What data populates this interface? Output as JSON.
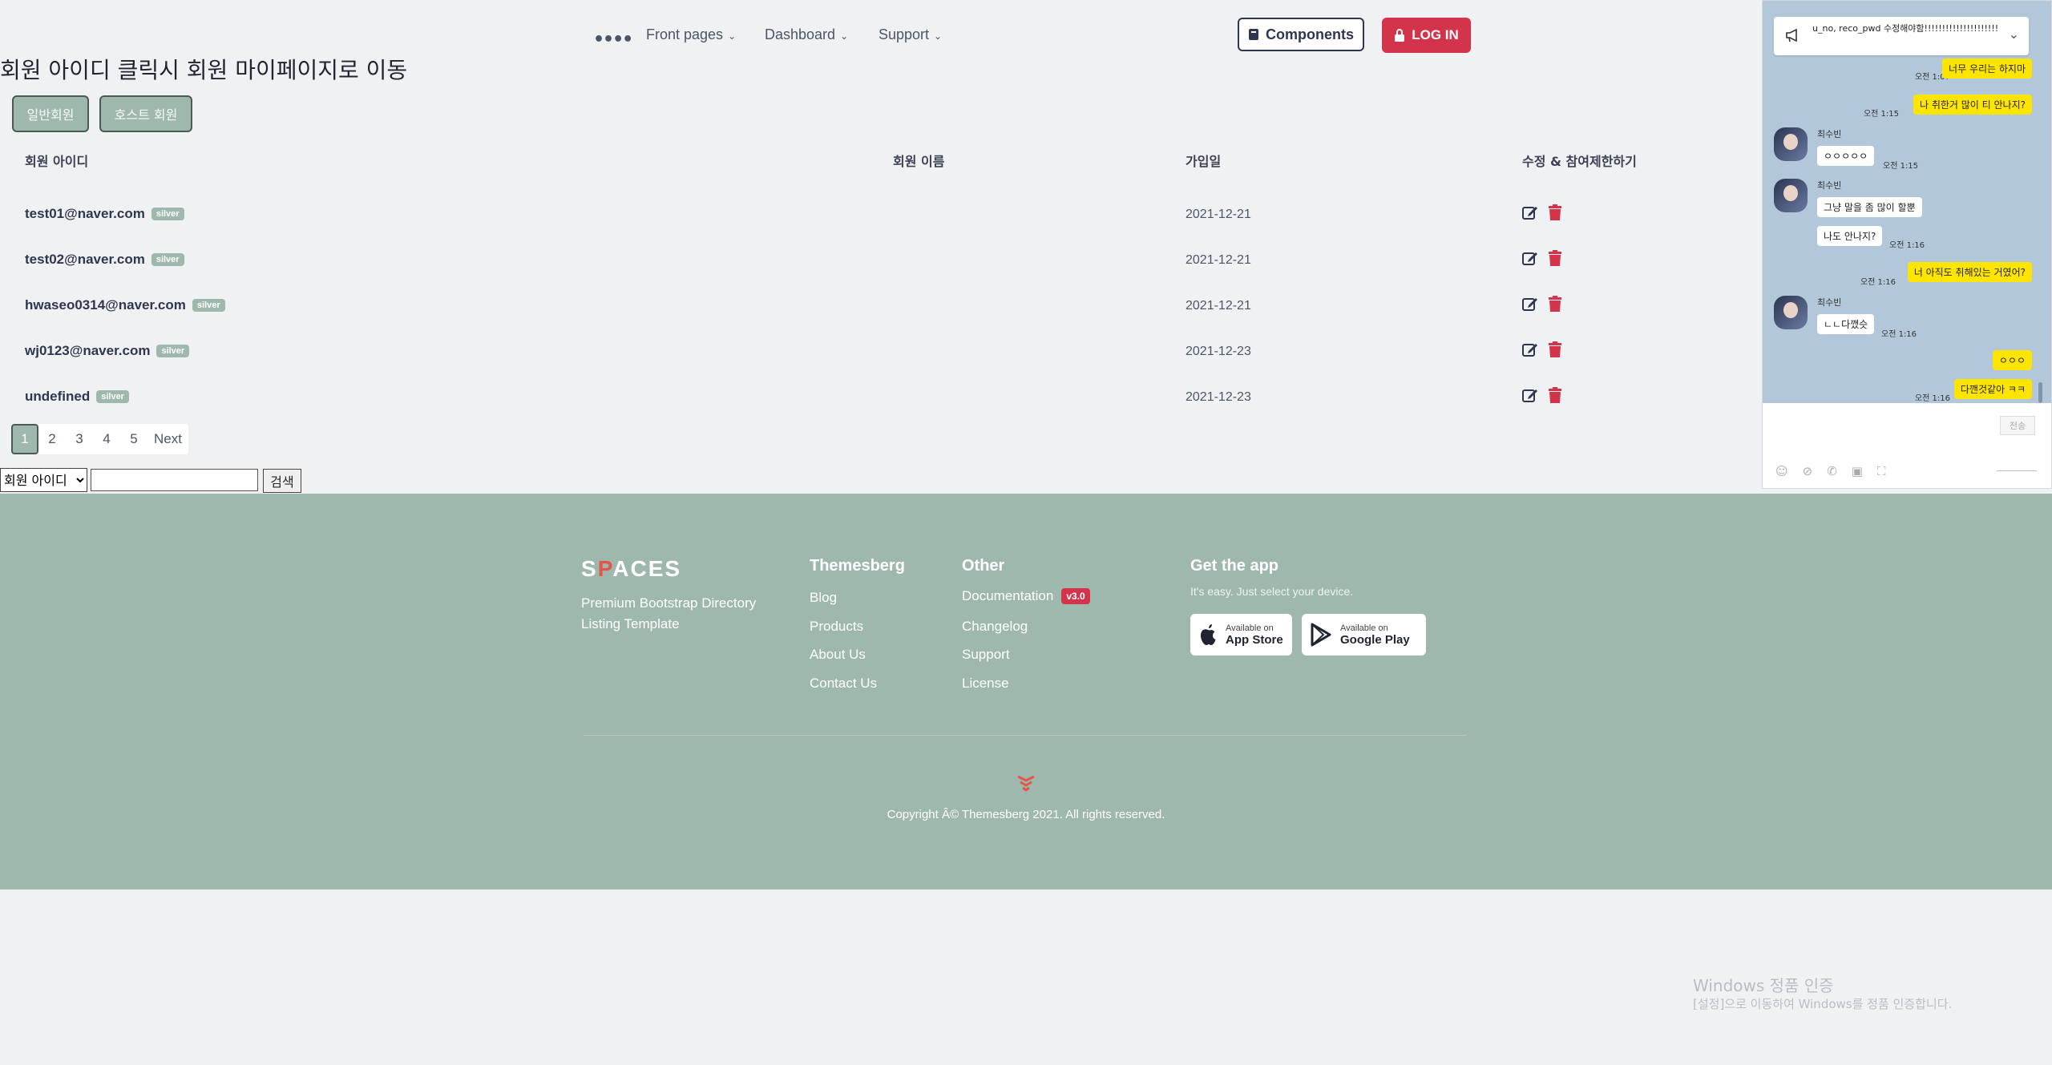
{
  "nav": {
    "dots": "••••",
    "front_pages": "Front pages",
    "dashboard": "Dashboard",
    "support": "Support",
    "components": "Components",
    "login": "LOG IN"
  },
  "page": {
    "title": "회원 아이디 클릭시 회원 마이페이지로 이동",
    "tabs": [
      "일반회원",
      "호스트 회원"
    ]
  },
  "table": {
    "headers": [
      "회원 아이디",
      "회원 이름",
      "가입일",
      "수정 & 참여제한하기"
    ],
    "rows": [
      {
        "id": "test01@naver.com",
        "badge": "silver",
        "date": "2021-12-21"
      },
      {
        "id": "test02@naver.com",
        "badge": "silver",
        "date": "2021-12-21"
      },
      {
        "id": "hwaseo0314@naver.com",
        "badge": "silver",
        "date": "2021-12-21"
      },
      {
        "id": "wj0123@naver.com",
        "badge": "silver",
        "date": "2021-12-23"
      },
      {
        "id": "undefined",
        "badge": "silver",
        "date": "2021-12-23"
      }
    ]
  },
  "pagination": [
    "1",
    "2",
    "3",
    "4",
    "5",
    "Next"
  ],
  "search": {
    "select_value": "회원 아이디",
    "button": "검색"
  },
  "footer": {
    "logo_s": "S",
    "logo_p": "P",
    "logo_rest": "ACES",
    "tagline": "Premium Bootstrap Directory Listing Template",
    "themesberg_title": "Themesberg",
    "themesberg_links": [
      "Blog",
      "Products",
      "About Us",
      "Contact Us"
    ],
    "other_title": "Other",
    "other_links": [
      "Documentation",
      "Changelog",
      "Support",
      "License"
    ],
    "doc_badge": "v3.0",
    "app_title": "Get the app",
    "app_sub": "It's easy. Just select your device.",
    "appstore_small": "Available on",
    "appstore_big": "App Store",
    "googleplay_small": "Available on",
    "googleplay_big": "Google Play",
    "copyright": "Copyright Â© Themesberg 2021. All rights reserved."
  },
  "chat": {
    "notice": "u_no, reco_pwd 수정해야함!!!!!!!!!!!!!!!!!!!!!",
    "messages": [
      {
        "from": "me",
        "text": "너무 우리는 하지마",
        "time": "오전 1:07"
      },
      {
        "from": "me",
        "text": "나 취한거 많이 티 안나지?",
        "time": "오전 1:15"
      },
      {
        "from": "other",
        "sender": "최수빈",
        "text": "ㅇㅇㅇㅇㅇ",
        "time": "오전 1:15"
      },
      {
        "from": "other",
        "sender": "최수빈",
        "text": "그냥 말을 좀 많이 할뿐",
        "time": ""
      },
      {
        "from": "other",
        "sender": "",
        "text": "나도 안나지?",
        "time": "오전 1:16"
      },
      {
        "from": "me",
        "text": "너 아직도 취해있는 거였어?",
        "time": "오전 1:16"
      },
      {
        "from": "other",
        "sender": "최수빈",
        "text": "ㄴㄴ다깼슷",
        "time": "오전 1:16"
      },
      {
        "from": "me",
        "text": "ㅇㅇㅇ",
        "time": ""
      },
      {
        "from": "me",
        "text": "다깬것같아 ㅋㅋ",
        "time": "오전 1:16"
      }
    ],
    "send_label": "전송"
  },
  "watermark": {
    "line1": "Windows 정품 인증",
    "line2": "[설정]으로 이동하여 Windows를 정품 인증합니다."
  },
  "colors": {
    "accent": "#9fb8ad",
    "danger": "#d3334b",
    "chat_bg": "#b2c7d9",
    "chat_mine": "#fee500"
  }
}
